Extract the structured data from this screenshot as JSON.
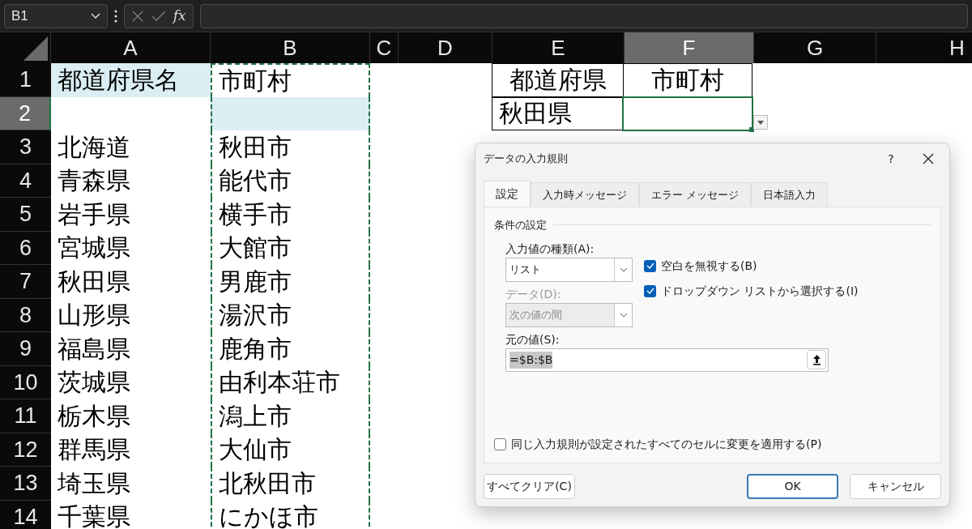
{
  "formula_bar": {
    "name_box": "B1",
    "function_button": "fx"
  },
  "columns": [
    {
      "label": "A",
      "selected": false,
      "marquee": false
    },
    {
      "label": "B",
      "selected": false,
      "marquee": true
    },
    {
      "label": "C",
      "selected": false,
      "marquee": false
    },
    {
      "label": "D",
      "selected": false,
      "marquee": false
    },
    {
      "label": "E",
      "selected": false,
      "marquee": false
    },
    {
      "label": "F",
      "selected": true,
      "marquee": false
    },
    {
      "label": "G",
      "selected": false,
      "marquee": false
    },
    {
      "label": "H",
      "selected": false,
      "marquee": false
    }
  ],
  "rows": [
    {
      "number": "1",
      "selected": false,
      "cells": {
        "A": {
          "text": "都道府県名",
          "highlighted": true
        },
        "B": {
          "text": "市町村",
          "highlighted": false
        },
        "E": {
          "text": "都道府県",
          "kind": "header",
          "bordered": true
        },
        "F": {
          "text": "市町村",
          "kind": "header",
          "bordered": true
        }
      }
    },
    {
      "number": "2",
      "selected": true,
      "cells": {
        "B": {
          "highlighted": true
        },
        "E": {
          "text": "秋田県",
          "kind": "value",
          "bordered": true
        },
        "F": {
          "kind": "value",
          "bordered": true,
          "selected": true,
          "has_dropdown": true
        }
      }
    },
    {
      "number": "3",
      "selected": false,
      "cells": {
        "A": {
          "text": "北海道"
        },
        "B": {
          "text": "秋田市"
        }
      }
    },
    {
      "number": "4",
      "selected": false,
      "cells": {
        "A": {
          "text": "青森県"
        },
        "B": {
          "text": "能代市"
        }
      }
    },
    {
      "number": "5",
      "selected": false,
      "cells": {
        "A": {
          "text": "岩手県"
        },
        "B": {
          "text": "横手市"
        }
      }
    },
    {
      "number": "6",
      "selected": false,
      "cells": {
        "A": {
          "text": "宮城県"
        },
        "B": {
          "text": "大館市"
        }
      }
    },
    {
      "number": "7",
      "selected": false,
      "cells": {
        "A": {
          "text": "秋田県"
        },
        "B": {
          "text": "男鹿市"
        }
      }
    },
    {
      "number": "8",
      "selected": false,
      "cells": {
        "A": {
          "text": "山形県"
        },
        "B": {
          "text": "湯沢市"
        }
      }
    },
    {
      "number": "9",
      "selected": false,
      "cells": {
        "A": {
          "text": "福島県"
        },
        "B": {
          "text": "鹿角市"
        }
      }
    },
    {
      "number": "10",
      "selected": false,
      "cells": {
        "A": {
          "text": "茨城県"
        },
        "B": {
          "text": "由利本荘市"
        }
      }
    },
    {
      "number": "11",
      "selected": false,
      "cells": {
        "A": {
          "text": "栃木県"
        },
        "B": {
          "text": "潟上市"
        }
      }
    },
    {
      "number": "12",
      "selected": false,
      "cells": {
        "A": {
          "text": "群馬県"
        },
        "B": {
          "text": "大仙市"
        }
      }
    },
    {
      "number": "13",
      "selected": false,
      "cells": {
        "A": {
          "text": "埼玉県"
        },
        "B": {
          "text": "北秋田市"
        }
      }
    },
    {
      "number": "14",
      "selected": false,
      "cells": {
        "A": {
          "text": "千葉県"
        },
        "B": {
          "text": "にかほ市"
        }
      }
    }
  ],
  "dialog": {
    "title": "データの入力規則",
    "help_button": "?",
    "tabs": [
      {
        "label": "設定",
        "selected": true
      },
      {
        "label": "入力時メッセージ",
        "selected": false
      },
      {
        "label": "エラー メッセージ",
        "selected": false
      },
      {
        "label": "日本語入力",
        "selected": false
      }
    ],
    "section_title": "条件の設定",
    "allow": {
      "label": "入力値の種類(A):",
      "value": "リスト",
      "disabled": false
    },
    "data": {
      "label": "データ(D):",
      "value": "次の値の間",
      "disabled": true
    },
    "checkboxes": [
      {
        "label": "空白を無視する(B)",
        "checked": true
      },
      {
        "label": "ドロップダウン リストから選択する(I)",
        "checked": true
      }
    ],
    "source": {
      "label": "元の値(S):",
      "value": "=$B:$B",
      "text_selected": true
    },
    "apply_all": {
      "label": "同じ入力規則が設定されたすべてのセルに変更を適用する(P)",
      "checked": false
    },
    "buttons": [
      {
        "label": "すべてクリア(C)",
        "kind": "secondary"
      },
      {
        "label": "OK",
        "kind": "default"
      },
      {
        "label": "キャンセル",
        "kind": "secondary"
      }
    ]
  }
}
